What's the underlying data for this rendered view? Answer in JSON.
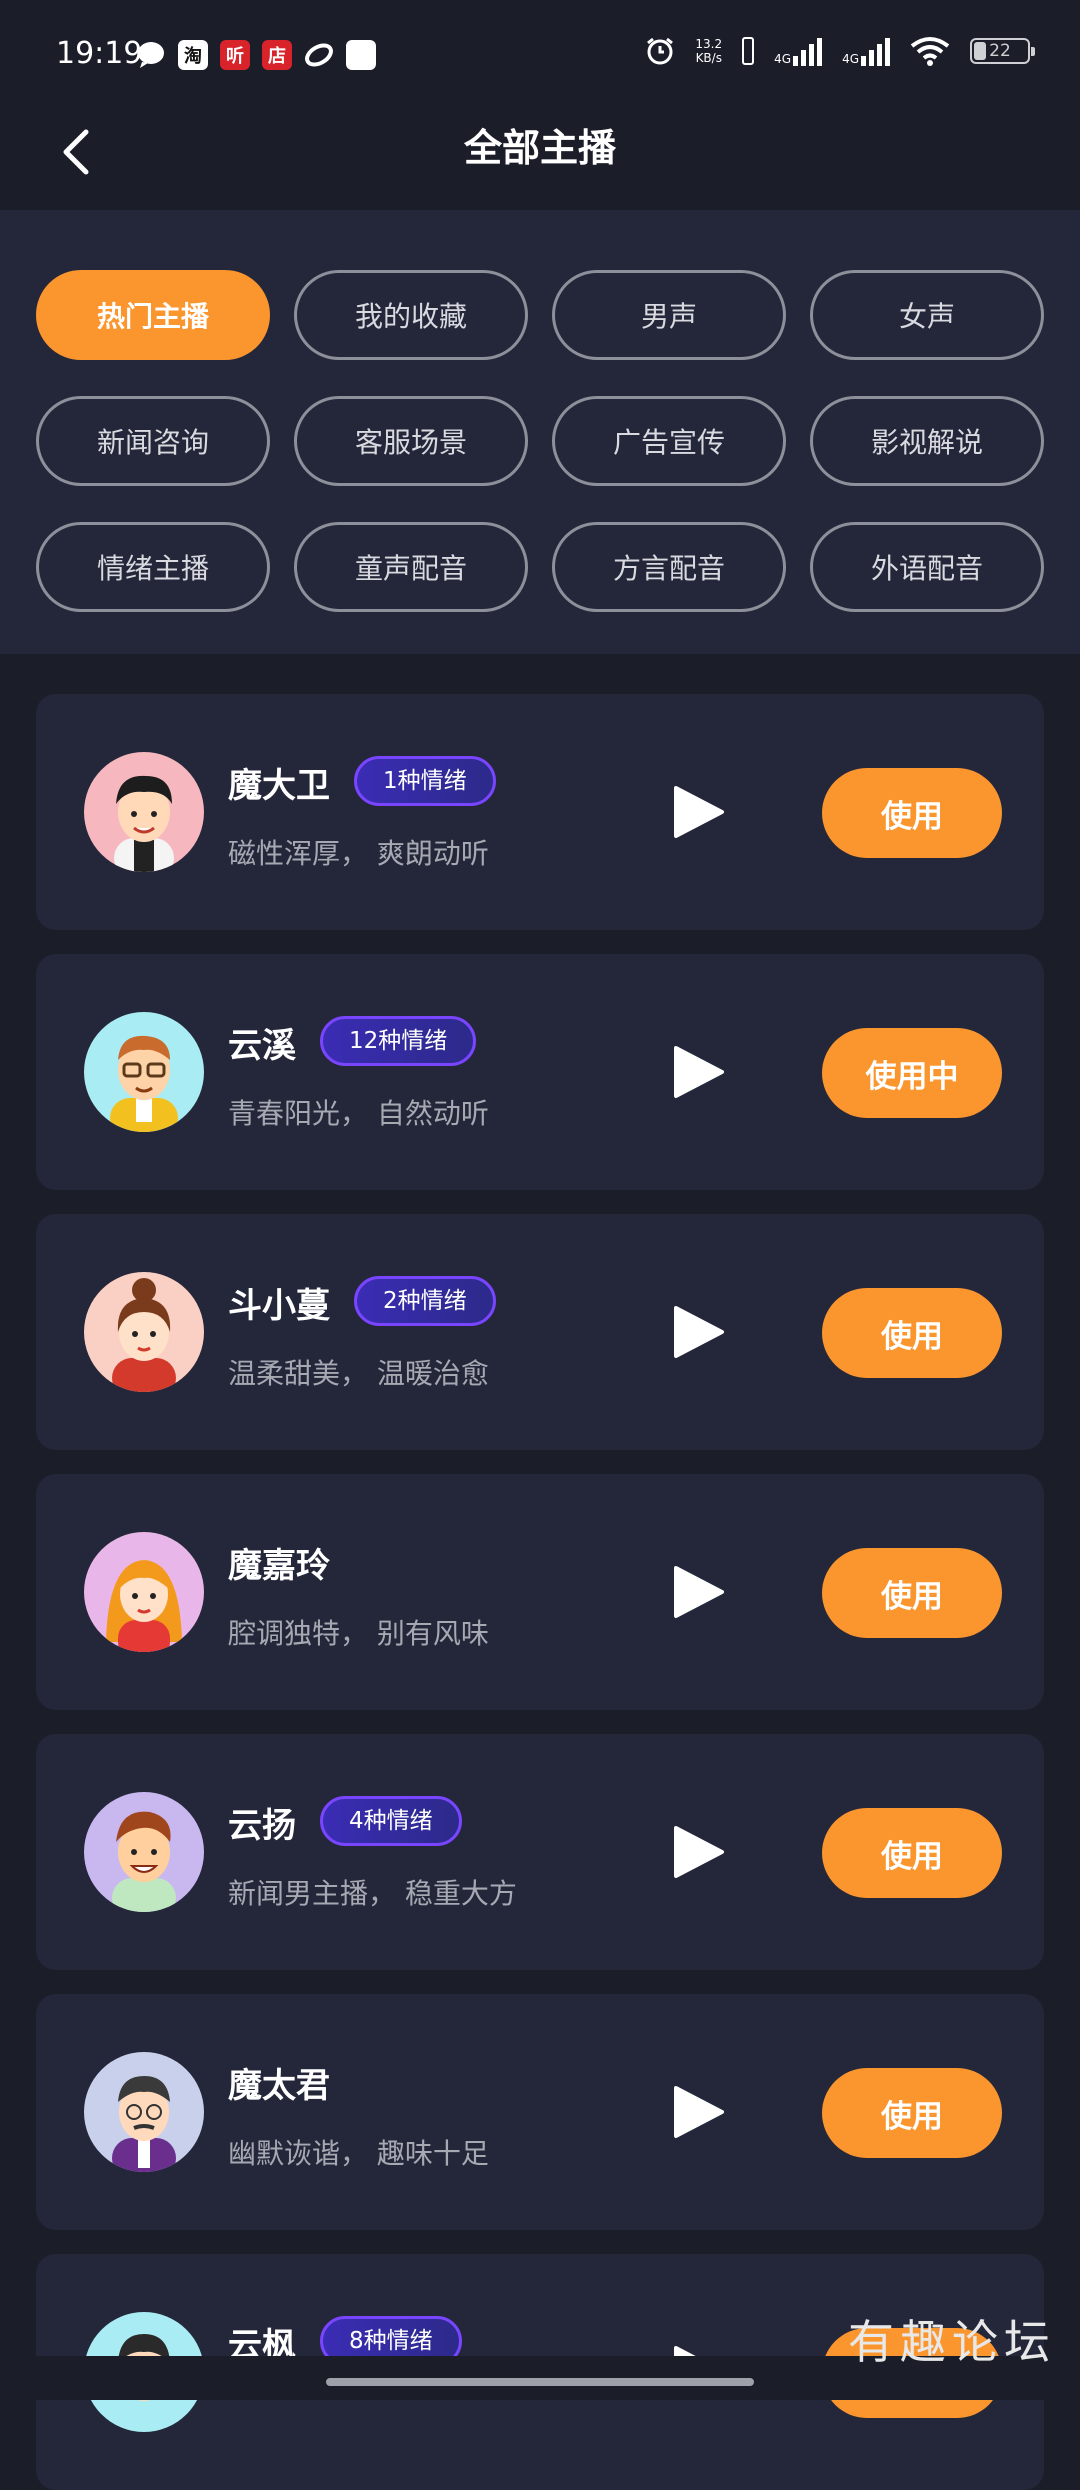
{
  "status_bar": {
    "time": "19:19",
    "net_speed_value": "13.2",
    "net_speed_unit": "KB/s",
    "net1": "4G",
    "net2": "4G",
    "battery": "22",
    "icons": [
      "message-icon",
      "taobao-icon",
      "listen-icon",
      "store-icon",
      "link-icon",
      "square-icon",
      "alarm-icon",
      "sim-icon",
      "signal-icon",
      "wifi-icon",
      "battery-icon"
    ],
    "app_labels": [
      "淘",
      "听",
      "店"
    ]
  },
  "header": {
    "title": "全部主播"
  },
  "filters": [
    [
      "热门主播",
      "我的收藏",
      "男声",
      "女声"
    ],
    [
      "新闻咨询",
      "客服场景",
      "广告宣传",
      "影视解说"
    ],
    [
      "情绪主播",
      "童声配音",
      "方言配音",
      "外语配音"
    ]
  ],
  "active_filter": "热门主播",
  "colors": {
    "accent": "#fb952d",
    "background": "#1b1d29",
    "card": "#24273a",
    "badge_border": "#7a45ff"
  },
  "anchors": [
    {
      "name": "魔大卫",
      "badge": "1种情绪",
      "desc": "磁性浑厚，  爽朗动听",
      "button": "使用"
    },
    {
      "name": "云溪",
      "badge": "12种情绪",
      "desc": "青春阳光，  自然动听",
      "button": "使用中"
    },
    {
      "name": "斗小蔓",
      "badge": "2种情绪",
      "desc": "温柔甜美，  温暖治愈",
      "button": "使用"
    },
    {
      "name": "魔嘉玲",
      "badge": "",
      "desc": "腔调独特，  别有风味",
      "button": "使用"
    },
    {
      "name": "云扬",
      "badge": "4种情绪",
      "desc": "新闻男主播，  稳重大方",
      "button": "使用"
    },
    {
      "name": "魔太君",
      "badge": "",
      "desc": "幽默诙谐，  趣味十足",
      "button": "使用"
    },
    {
      "name": "云枫",
      "badge": "8种情绪",
      "desc": "",
      "button": "使用"
    }
  ],
  "watermark": "有趣论坛"
}
